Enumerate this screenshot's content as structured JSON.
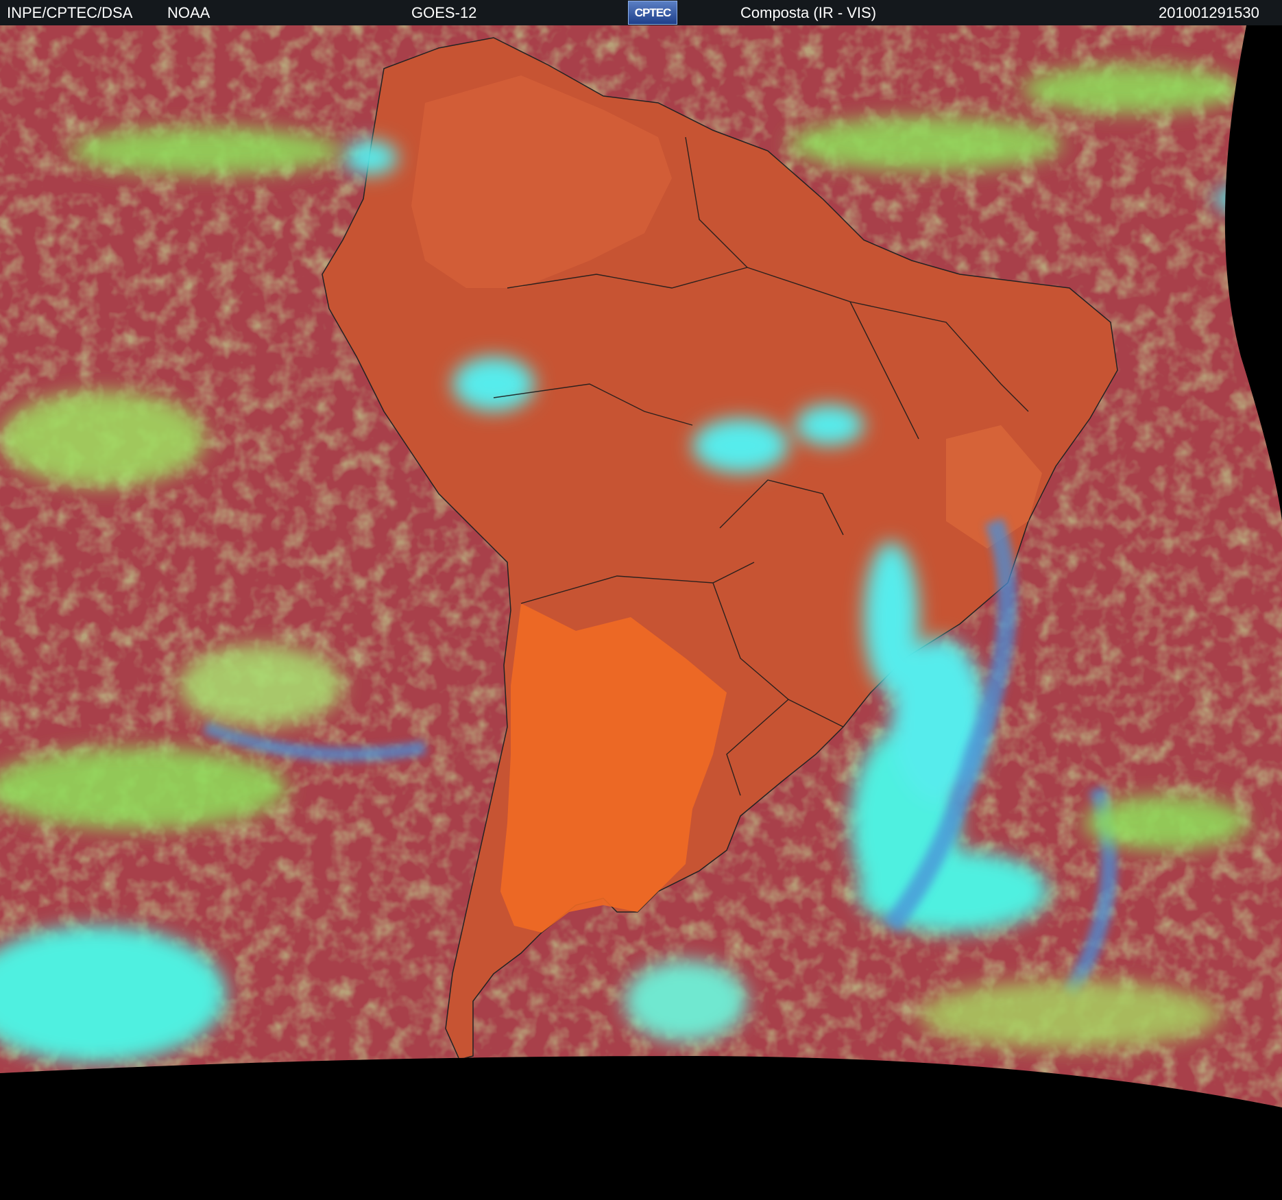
{
  "header": {
    "org": "INPE/CPTEC/DSA",
    "agency": "NOAA",
    "satellite": "GOES-12",
    "logo_text": "CPTEC",
    "product": "Composta (IR - VIS)",
    "timestamp": "201001291530"
  },
  "imagery": {
    "subject": "satellite-composite-south-america",
    "colors": {
      "ocean_clear": "#a8404a",
      "land_clear": "#d9622e",
      "desert_land": "#ef6a24",
      "low_cloud": "#8fe05a",
      "high_cloud": "#4ff0e0",
      "mid_cloud": "#4a8fd8",
      "outer_space": "#000000"
    }
  }
}
